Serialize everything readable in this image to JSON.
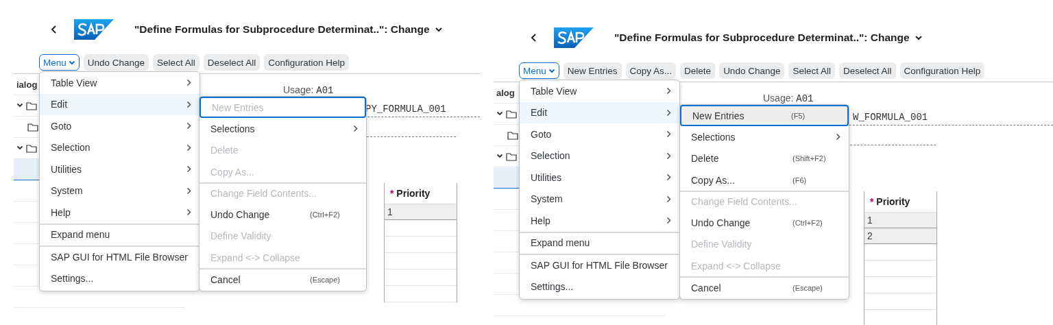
{
  "panels": [
    {
      "title": "\"Define Formulas for Subprocedure Determinat..\": Change",
      "toolbar": [
        {
          "label": "Menu",
          "kind": "menu"
        },
        {
          "label": "Undo Change",
          "kind": "button"
        },
        {
          "label": "Select All",
          "kind": "button"
        },
        {
          "label": "Deselect All",
          "kind": "button"
        },
        {
          "label": "Configuration Help",
          "kind": "button"
        }
      ],
      "tree_label": "ialog",
      "usage_label": "Usage:",
      "usage_value": "A01",
      "formula": "PY_FORMULA_001",
      "priority": {
        "required_mark": "*",
        "header": "Priority",
        "rows": [
          "1"
        ]
      },
      "menu": [
        {
          "label": "Table View",
          "submenu": true,
          "selected": false,
          "separator_before": false
        },
        {
          "label": "Edit",
          "submenu": true,
          "selected": true,
          "separator_before": false
        },
        {
          "label": "Goto",
          "submenu": true,
          "selected": false,
          "separator_before": false
        },
        {
          "label": "Selection",
          "submenu": true,
          "selected": false,
          "separator_before": false
        },
        {
          "label": "Utilities",
          "submenu": true,
          "selected": false,
          "separator_before": false
        },
        {
          "label": "System",
          "submenu": true,
          "selected": false,
          "separator_before": false
        },
        {
          "label": "Help",
          "submenu": true,
          "selected": false,
          "separator_before": false
        },
        {
          "label": "Expand menu",
          "submenu": false,
          "selected": false,
          "separator_before": true
        },
        {
          "label": "SAP GUI for HTML File Browser",
          "submenu": false,
          "selected": false,
          "separator_before": true
        },
        {
          "label": "Settings...",
          "submenu": false,
          "selected": false,
          "separator_before": false
        }
      ],
      "submenu": [
        {
          "label": "New Entries",
          "disabled": true,
          "selected": true,
          "submenu": false,
          "separator_before": false
        },
        {
          "label": "Selections",
          "disabled": false,
          "selected": false,
          "submenu": true,
          "separator_before": false
        },
        {
          "label": "Delete",
          "disabled": true,
          "selected": false,
          "submenu": false,
          "separator_before": false
        },
        {
          "label": "Copy As...",
          "disabled": true,
          "selected": false,
          "submenu": false,
          "separator_before": false
        },
        {
          "label": "Change Field Contents...",
          "disabled": true,
          "selected": false,
          "submenu": false,
          "separator_before": true
        },
        {
          "label": "Undo Change",
          "shortcut": "(Ctrl+F2)",
          "disabled": false,
          "selected": false,
          "submenu": false,
          "separator_before": false
        },
        {
          "label": "Define Validity",
          "disabled": true,
          "selected": false,
          "submenu": false,
          "separator_before": false
        },
        {
          "label": "Expand <-> Collapse",
          "disabled": true,
          "selected": false,
          "submenu": false,
          "separator_before": false
        },
        {
          "label": "Cancel",
          "shortcut": "(Escape)",
          "disabled": false,
          "selected": false,
          "submenu": false,
          "separator_before": true
        }
      ]
    },
    {
      "title": "\"Define Formulas for Subprocedure Determinat..\": Change",
      "toolbar": [
        {
          "label": "Menu",
          "kind": "menu"
        },
        {
          "label": "New Entries",
          "kind": "button"
        },
        {
          "label": "Copy As...",
          "kind": "button"
        },
        {
          "label": "Delete",
          "kind": "button"
        },
        {
          "label": "Undo Change",
          "kind": "button"
        },
        {
          "label": "Select All",
          "kind": "button"
        },
        {
          "label": "Deselect All",
          "kind": "button"
        },
        {
          "label": "Configuration Help",
          "kind": "button"
        }
      ],
      "tree_label": "alog",
      "usage_label": "Usage:",
      "usage_value": "A01",
      "formula": "W_FORMULA_001",
      "priority": {
        "required_mark": "*",
        "header": "Priority",
        "rows": [
          "1",
          "2"
        ]
      },
      "menu": [
        {
          "label": "Table View",
          "submenu": true,
          "selected": false,
          "separator_before": false
        },
        {
          "label": "Edit",
          "submenu": true,
          "selected": true,
          "separator_before": false
        },
        {
          "label": "Goto",
          "submenu": true,
          "selected": false,
          "separator_before": false
        },
        {
          "label": "Selection",
          "submenu": true,
          "selected": false,
          "separator_before": false
        },
        {
          "label": "Utilities",
          "submenu": true,
          "selected": false,
          "separator_before": false
        },
        {
          "label": "System",
          "submenu": true,
          "selected": false,
          "separator_before": false
        },
        {
          "label": "Help",
          "submenu": true,
          "selected": false,
          "separator_before": false
        },
        {
          "label": "Expand menu",
          "submenu": false,
          "selected": false,
          "separator_before": true
        },
        {
          "label": "SAP GUI for HTML File Browser",
          "submenu": false,
          "selected": false,
          "separator_before": true
        },
        {
          "label": "Settings...",
          "submenu": false,
          "selected": false,
          "separator_before": false
        }
      ],
      "submenu": [
        {
          "label": "New Entries",
          "shortcut": "(F5)",
          "disabled": false,
          "selected": true,
          "submenu": false,
          "separator_before": false
        },
        {
          "label": "Selections",
          "disabled": false,
          "selected": false,
          "submenu": true,
          "separator_before": false
        },
        {
          "label": "Delete",
          "shortcut": "(Shift+F2)",
          "disabled": false,
          "selected": false,
          "submenu": false,
          "separator_before": false
        },
        {
          "label": "Copy As...",
          "shortcut": "(F6)",
          "disabled": false,
          "selected": false,
          "submenu": false,
          "separator_before": false
        },
        {
          "label": "Change Field Contents...",
          "disabled": true,
          "selected": false,
          "submenu": false,
          "separator_before": true
        },
        {
          "label": "Undo Change",
          "shortcut": "(Ctrl+F2)",
          "disabled": false,
          "selected": false,
          "submenu": false,
          "separator_before": false
        },
        {
          "label": "Define Validity",
          "disabled": true,
          "selected": false,
          "submenu": false,
          "separator_before": false
        },
        {
          "label": "Expand <-> Collapse",
          "disabled": true,
          "selected": false,
          "submenu": false,
          "separator_before": false
        },
        {
          "label": "Cancel",
          "shortcut": "(Escape)",
          "disabled": false,
          "selected": false,
          "submenu": false,
          "separator_before": true
        }
      ]
    }
  ]
}
